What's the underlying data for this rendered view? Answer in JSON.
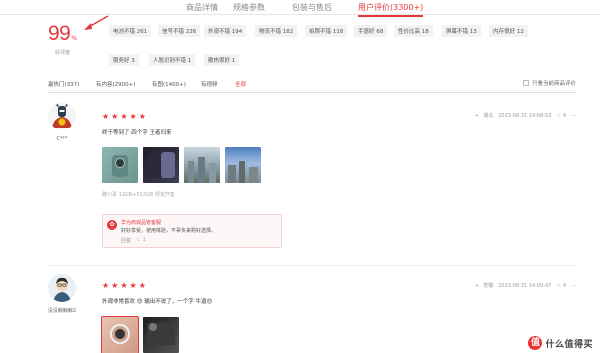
{
  "tabs": [
    {
      "label": "商品详情"
    },
    {
      "label": "规格参数"
    },
    {
      "label": "包装与售后"
    },
    {
      "label": "用户评价(3300+)"
    }
  ],
  "rating": {
    "score": "99",
    "unit": "%",
    "label": "好评度"
  },
  "tags": [
    {
      "label": "电池不错 261"
    },
    {
      "label": "信号不错 226"
    },
    {
      "label": "外观不错 194"
    },
    {
      "label": "物流不错 182"
    },
    {
      "label": "拍照不错 118"
    },
    {
      "label": "手感好 68"
    },
    {
      "label": "性价比高 18"
    },
    {
      "label": "屏幕不错 13"
    },
    {
      "label": "内存很好 12"
    },
    {
      "label": "服务好 3"
    },
    {
      "label": "人脸识别不错 1"
    },
    {
      "label": "散热很好 1"
    }
  ],
  "filters": {
    "items": [
      {
        "label": "最热门(337)"
      },
      {
        "label": "有内容(2900+)"
      },
      {
        "label": "有图(1400+)"
      },
      {
        "label": "有视频"
      },
      {
        "label": "全部"
      }
    ],
    "only_current": "只看当前商品评价"
  },
  "reviews": [
    {
      "username": "C***",
      "rating": 5,
      "text": "终于等到了 四个字 王者归来",
      "location": "湖北",
      "date": "2023-08-31 14:08:53",
      "likes": "4",
      "spec": "雅川青 12GB+512GB 现货开售",
      "reply": {
        "name": "华为商城品管客服",
        "text": "好好享受，使用体验，不辜负来购好选择。",
        "reply_label": "回复",
        "like_count": "1"
      }
    },
    {
      "username": "没没鲸鲸鲸2",
      "rating": 5,
      "text": "外观非常喜欢 😍 输出不说了，一个字 牛逼😍",
      "location": "安徽",
      "date": "2023-08-31 14:09:47",
      "likes": "4"
    }
  ],
  "watermark": {
    "logo": "值",
    "text": "什么值得买"
  }
}
